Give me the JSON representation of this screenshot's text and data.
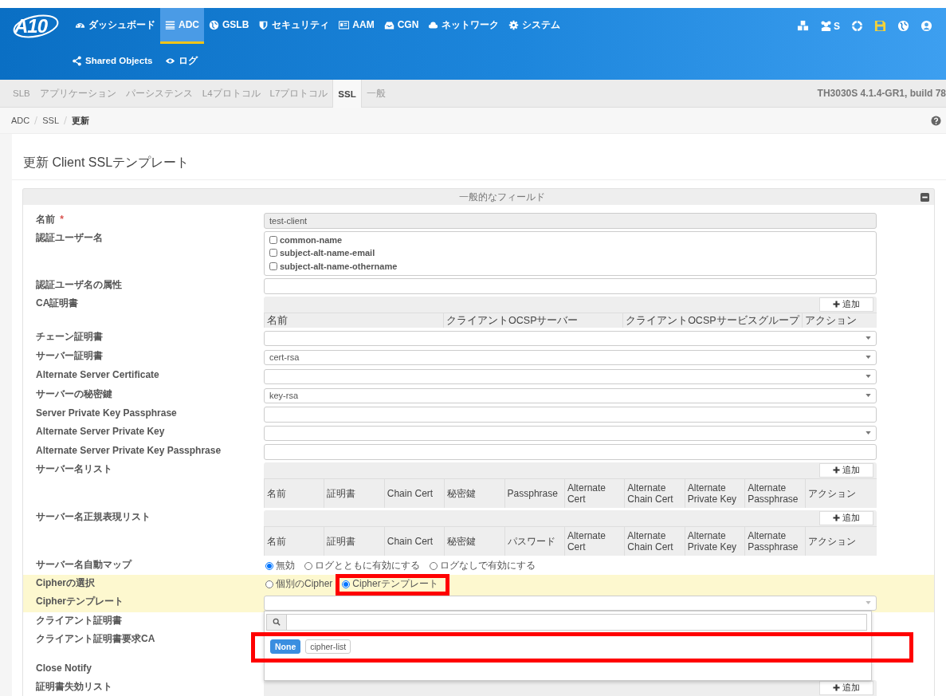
{
  "header": {
    "logo": "A10",
    "nav": [
      {
        "kind": "dashboard",
        "label": "ダッシュボード",
        "selected": false
      },
      {
        "kind": "list",
        "label": "ADC",
        "selected": true
      },
      {
        "kind": "globe",
        "label": "GSLB",
        "selected": false
      },
      {
        "kind": "shield",
        "label": "セキュリティ",
        "selected": false
      },
      {
        "kind": "card",
        "label": "AAM",
        "selected": false
      },
      {
        "kind": "inbox",
        "label": "CGN",
        "selected": false
      },
      {
        "kind": "cloud",
        "label": "ネットワーク",
        "selected": false
      },
      {
        "kind": "gear",
        "label": "システム",
        "selected": false
      }
    ],
    "subnav": [
      {
        "kind": "share",
        "label": "Shared Objects"
      },
      {
        "kind": "eye",
        "label": "ログ"
      }
    ],
    "tools": [
      {
        "kind": "cubes"
      },
      {
        "kind": "users",
        "label": "S"
      },
      {
        "kind": "lifebuoy"
      },
      {
        "kind": "save"
      },
      {
        "kind": "globe"
      },
      {
        "kind": "user"
      }
    ]
  },
  "tabs": [
    {
      "label": "SLB",
      "selected": false
    },
    {
      "label": "アプリケーション",
      "selected": false
    },
    {
      "label": "パーシステンス",
      "selected": false
    },
    {
      "label": "L4プロトコル",
      "selected": false
    },
    {
      "label": "L7プロトコル",
      "selected": false
    },
    {
      "label": "SSL",
      "selected": true
    },
    {
      "label": "一般",
      "selected": false
    }
  ],
  "version": "TH3030S 4.1.4-GR1, build 78",
  "breadcrumb": [
    {
      "label": "ADC",
      "current": false
    },
    {
      "label": "SSL",
      "current": false
    },
    {
      "label": "更新",
      "current": true
    }
  ],
  "page_title": "更新 Client SSLテンプレート",
  "panel": {
    "title": "一般的なフィールド",
    "expanded": true,
    "fields": [
      {
        "label": "名前",
        "required_mark": "*",
        "kind": "text",
        "value": "test-client",
        "readonly": true
      },
      {
        "label": "認証ユーザー名",
        "kind": "checkboxes",
        "options": [
          {
            "label": "common-name",
            "checked": false
          },
          {
            "label": "subject-alt-name-email",
            "checked": false
          },
          {
            "label": "subject-alt-name-othername",
            "checked": false
          }
        ]
      },
      {
        "label": "認証ユーザ名の属性",
        "kind": "text"
      },
      {
        "label": "CA証明書",
        "kind": "table",
        "add_label": "追加",
        "columns": [
          "名前",
          "クライアントOCSPサーバー",
          "クライアントOCSPサービスグループ",
          "アクション"
        ]
      },
      {
        "label": "チェーン証明書",
        "kind": "select"
      },
      {
        "label": "サーバー証明書",
        "kind": "select",
        "value": "cert-rsa"
      },
      {
        "label": "Alternate Server Certificate",
        "kind": "select"
      },
      {
        "label": "サーバーの秘密鍵",
        "kind": "select",
        "value": "key-rsa"
      },
      {
        "label": "Server Private Key Passphrase",
        "kind": "text"
      },
      {
        "label": "Alternate Server Private Key",
        "kind": "select"
      },
      {
        "label": "Alternate Server Private Key Passphrase",
        "kind": "text"
      },
      {
        "label": "サーバー名リスト",
        "kind": "table",
        "add_label": "追加",
        "columns": [
          "名前",
          "証明書",
          "Chain Cert",
          "秘密鍵",
          "Passphrase",
          "Alternate Cert",
          "Alternate Chain Cert",
          "Alternate Private Key",
          "Alternate Passphrase",
          "アクション"
        ]
      },
      {
        "label": "サーバー名正規表現リスト",
        "kind": "table",
        "add_label": "追加",
        "columns": [
          "名前",
          "証明書",
          "Chain Cert",
          "秘密鍵",
          "パスワード",
          "Alternate Cert",
          "Alternate Chain Cert",
          "Alternate Private Key",
          "Alternate Passphrase",
          "アクション"
        ]
      },
      {
        "label": "サーバー名自動マップ",
        "kind": "radio",
        "options": [
          {
            "label": "無効",
            "selected": true,
            "annotated": false
          },
          {
            "label": "ログとともに有効にする",
            "selected": false,
            "annotated": false
          },
          {
            "label": "ログなしで有効にする",
            "selected": false,
            "annotated": false
          }
        ]
      },
      {
        "label": "Cipherの選択",
        "kind": "radio",
        "highlighted": true,
        "options": [
          {
            "label": "個別のCipher",
            "selected": false,
            "annotated": false
          },
          {
            "label": "Cipherテンプレート",
            "selected": true,
            "annotated": true
          }
        ]
      },
      {
        "label": "Cipherテンプレート",
        "kind": "select",
        "highlighted": true,
        "expanded": true,
        "options_annotated": true,
        "options": [
          {
            "label": "None",
            "selected": true
          },
          {
            "label": "cipher-list",
            "selected": false
          }
        ]
      },
      {
        "label": "クライアント証明書",
        "kind": "covered"
      },
      {
        "label": "クライアント証明書要求CA",
        "kind": "covered_table"
      },
      {
        "label": "Close Notify",
        "kind": "covered"
      },
      {
        "label": "証明書失効リスト",
        "kind": "table",
        "add_label": "追加"
      }
    ]
  }
}
